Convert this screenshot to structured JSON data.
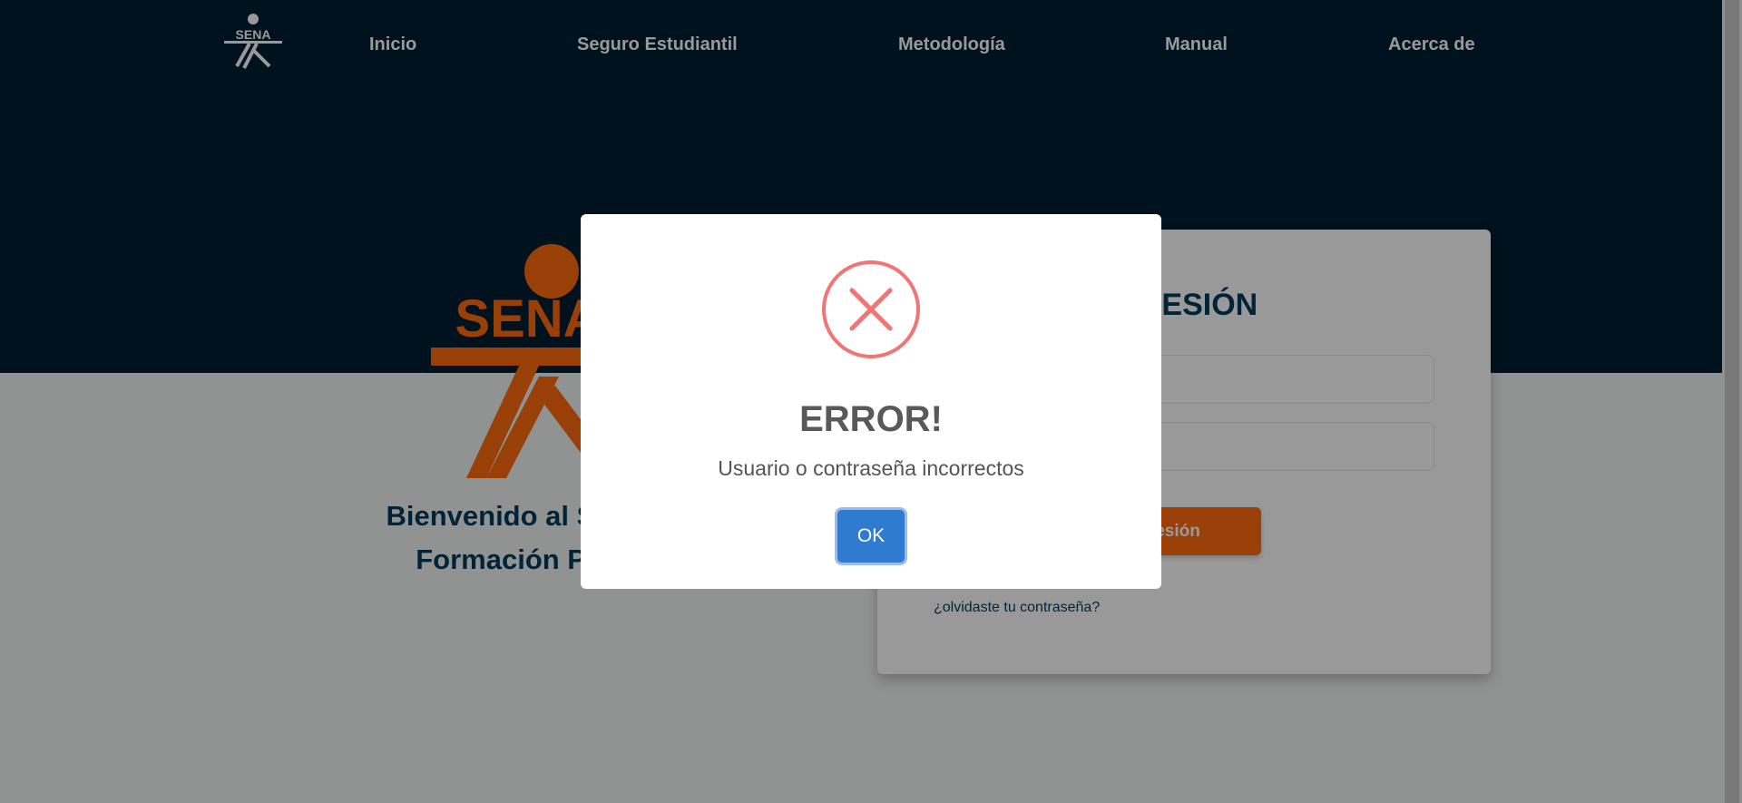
{
  "nav": {
    "logo_text": "SENA",
    "items": [
      {
        "label": "Inicio"
      },
      {
        "label": "Seguro Estudiantil"
      },
      {
        "label": "Metodología"
      },
      {
        "label": "Manual"
      },
      {
        "label": "Acerca de"
      }
    ]
  },
  "hero": {
    "logo_text": "SENA",
    "welcome_line1": "Bienvenido al Sistema",
    "welcome_line2": "Formación Profes"
  },
  "login": {
    "title": "R SESIÓN",
    "username": {
      "value": "",
      "placeholder": ""
    },
    "password": {
      "value": "",
      "placeholder": ""
    },
    "submit_label": "iar sesión",
    "forgot_link": "¿olvidaste tu contraseña?"
  },
  "modal": {
    "icon": "error-x-icon",
    "title": "ERROR!",
    "message": "Usuario o contraseña incorrectos",
    "ok_label": "OK"
  },
  "colors": {
    "navy": "#001e33",
    "sena_orange": "#ff6b0f",
    "error_red": "#f27474",
    "ok_blue": "#2f7bd0"
  }
}
